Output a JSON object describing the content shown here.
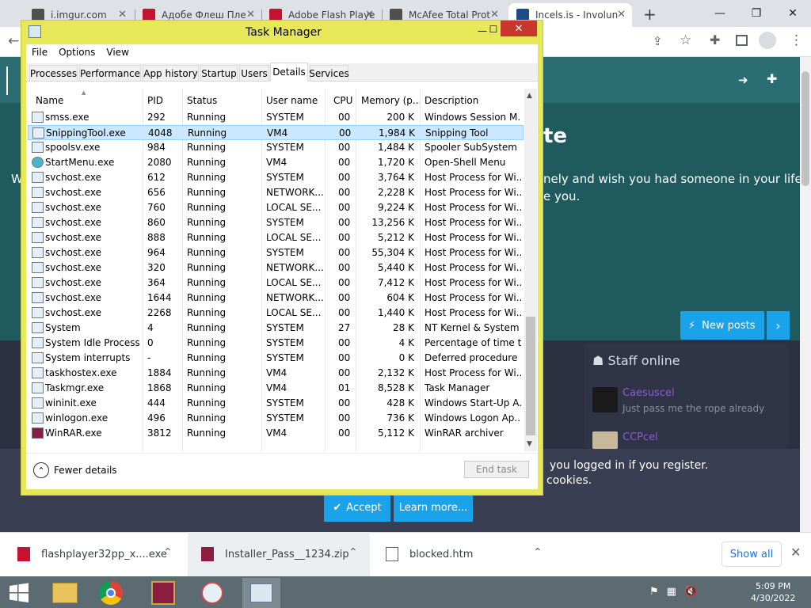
{
  "browser": {
    "tabs": [
      {
        "title": "i.imgur.com",
        "favicon_color": "#4f4f4f"
      },
      {
        "title": "Адобе Флеш Пле",
        "favicon_color": "#c41230"
      },
      {
        "title": "Adobe Flash Playe",
        "favicon_color": "#c41230"
      },
      {
        "title": "McAfee Total Prot",
        "favicon_color": "#4f4f4f"
      },
      {
        "title": "Incels.is - Involun",
        "favicon_color": "#1f4b8a"
      }
    ],
    "window_controls": {
      "minimize": "—",
      "restore": "❐",
      "close": "✕"
    },
    "new_tab": "+"
  },
  "website": {
    "hero_title_fragment": "te",
    "hero_line1_left": "W",
    "hero_line1_right": "nely and wish you had someone in your life?",
    "hero_line2_right": "e you.",
    "new_posts_label": "New posts",
    "staff_title": "Staff online",
    "staff": [
      {
        "name": "Caesuscel",
        "subtitle": "Just pass me the rope already"
      },
      {
        "name": "CCPcel",
        "subtitle": ""
      }
    ],
    "cookie_line1": "you logged in if you register.",
    "cookie_line2": "cookies.",
    "accept_label": "Accept",
    "learn_more_label": "Learn more..."
  },
  "downloads": {
    "items": [
      {
        "name": "flashplayer32pp_x....exe"
      },
      {
        "name": "Installer_Pass__1234.zip"
      },
      {
        "name": "blocked.htm"
      }
    ],
    "show_all": "Show all"
  },
  "taskbar": {
    "time": "5:09 PM",
    "date": "4/30/2022"
  },
  "task_manager": {
    "title": "Task Manager",
    "menu": [
      "File",
      "Options",
      "View"
    ],
    "tabs": [
      "Processes",
      "Performance",
      "App history",
      "Startup",
      "Users",
      "Details",
      "Services"
    ],
    "selected_tab": "Details",
    "columns": [
      "Name",
      "PID",
      "Status",
      "User name",
      "CPU",
      "Memory (p...",
      "Description"
    ],
    "rows": [
      {
        "name": "smss.exe",
        "pid": "292",
        "status": "Running",
        "user": "SYSTEM",
        "cpu": "00",
        "mem": "200 K",
        "desc": "Windows Session M..."
      },
      {
        "name": "SnippingTool.exe",
        "pid": "4048",
        "status": "Running",
        "user": "VM4",
        "cpu": "00",
        "mem": "1,984 K",
        "desc": "Snipping Tool"
      },
      {
        "name": "spoolsv.exe",
        "pid": "984",
        "status": "Running",
        "user": "SYSTEM",
        "cpu": "00",
        "mem": "1,484 K",
        "desc": "Spooler SubSystem ..."
      },
      {
        "name": "StartMenu.exe",
        "pid": "2080",
        "status": "Running",
        "user": "VM4",
        "cpu": "00",
        "mem": "1,720 K",
        "desc": "Open-Shell Menu"
      },
      {
        "name": "svchost.exe",
        "pid": "612",
        "status": "Running",
        "user": "SYSTEM",
        "cpu": "00",
        "mem": "3,764 K",
        "desc": "Host Process for Wi..."
      },
      {
        "name": "svchost.exe",
        "pid": "656",
        "status": "Running",
        "user": "NETWORK...",
        "cpu": "00",
        "mem": "2,228 K",
        "desc": "Host Process for Wi..."
      },
      {
        "name": "svchost.exe",
        "pid": "760",
        "status": "Running",
        "user": "LOCAL SE...",
        "cpu": "00",
        "mem": "9,224 K",
        "desc": "Host Process for Wi..."
      },
      {
        "name": "svchost.exe",
        "pid": "860",
        "status": "Running",
        "user": "SYSTEM",
        "cpu": "00",
        "mem": "13,256 K",
        "desc": "Host Process for Wi..."
      },
      {
        "name": "svchost.exe",
        "pid": "888",
        "status": "Running",
        "user": "LOCAL SE...",
        "cpu": "00",
        "mem": "5,212 K",
        "desc": "Host Process for Wi..."
      },
      {
        "name": "svchost.exe",
        "pid": "964",
        "status": "Running",
        "user": "SYSTEM",
        "cpu": "00",
        "mem": "55,304 K",
        "desc": "Host Process for Wi..."
      },
      {
        "name": "svchost.exe",
        "pid": "320",
        "status": "Running",
        "user": "NETWORK...",
        "cpu": "00",
        "mem": "5,440 K",
        "desc": "Host Process for Wi..."
      },
      {
        "name": "svchost.exe",
        "pid": "364",
        "status": "Running",
        "user": "LOCAL SE...",
        "cpu": "00",
        "mem": "7,412 K",
        "desc": "Host Process for Wi..."
      },
      {
        "name": "svchost.exe",
        "pid": "1644",
        "status": "Running",
        "user": "NETWORK...",
        "cpu": "00",
        "mem": "604 K",
        "desc": "Host Process for Wi..."
      },
      {
        "name": "svchost.exe",
        "pid": "2268",
        "status": "Running",
        "user": "LOCAL SE...",
        "cpu": "00",
        "mem": "1,440 K",
        "desc": "Host Process for Wi..."
      },
      {
        "name": "System",
        "pid": "4",
        "status": "Running",
        "user": "SYSTEM",
        "cpu": "27",
        "mem": "28 K",
        "desc": "NT Kernel & System"
      },
      {
        "name": "System Idle Process",
        "pid": "0",
        "status": "Running",
        "user": "SYSTEM",
        "cpu": "00",
        "mem": "4 K",
        "desc": "Percentage of time t..."
      },
      {
        "name": "System interrupts",
        "pid": "-",
        "status": "Running",
        "user": "SYSTEM",
        "cpu": "00",
        "mem": "0 K",
        "desc": "Deferred procedure ..."
      },
      {
        "name": "taskhostex.exe",
        "pid": "1884",
        "status": "Running",
        "user": "VM4",
        "cpu": "00",
        "mem": "2,132 K",
        "desc": "Host Process for Wi..."
      },
      {
        "name": "Taskmgr.exe",
        "pid": "1868",
        "status": "Running",
        "user": "VM4",
        "cpu": "01",
        "mem": "8,528 K",
        "desc": "Task Manager"
      },
      {
        "name": "wininit.exe",
        "pid": "444",
        "status": "Running",
        "user": "SYSTEM",
        "cpu": "00",
        "mem": "428 K",
        "desc": "Windows Start-Up A..."
      },
      {
        "name": "winlogon.exe",
        "pid": "496",
        "status": "Running",
        "user": "SYSTEM",
        "cpu": "00",
        "mem": "736 K",
        "desc": "Windows Logon Ap..."
      },
      {
        "name": "WinRAR.exe",
        "pid": "3812",
        "status": "Running",
        "user": "VM4",
        "cpu": "00",
        "mem": "5,112 K",
        "desc": "WinRAR archiver"
      }
    ],
    "selected_row": "SnippingTool.exe",
    "fewer_details": "Fewer details",
    "end_task": "End task"
  }
}
